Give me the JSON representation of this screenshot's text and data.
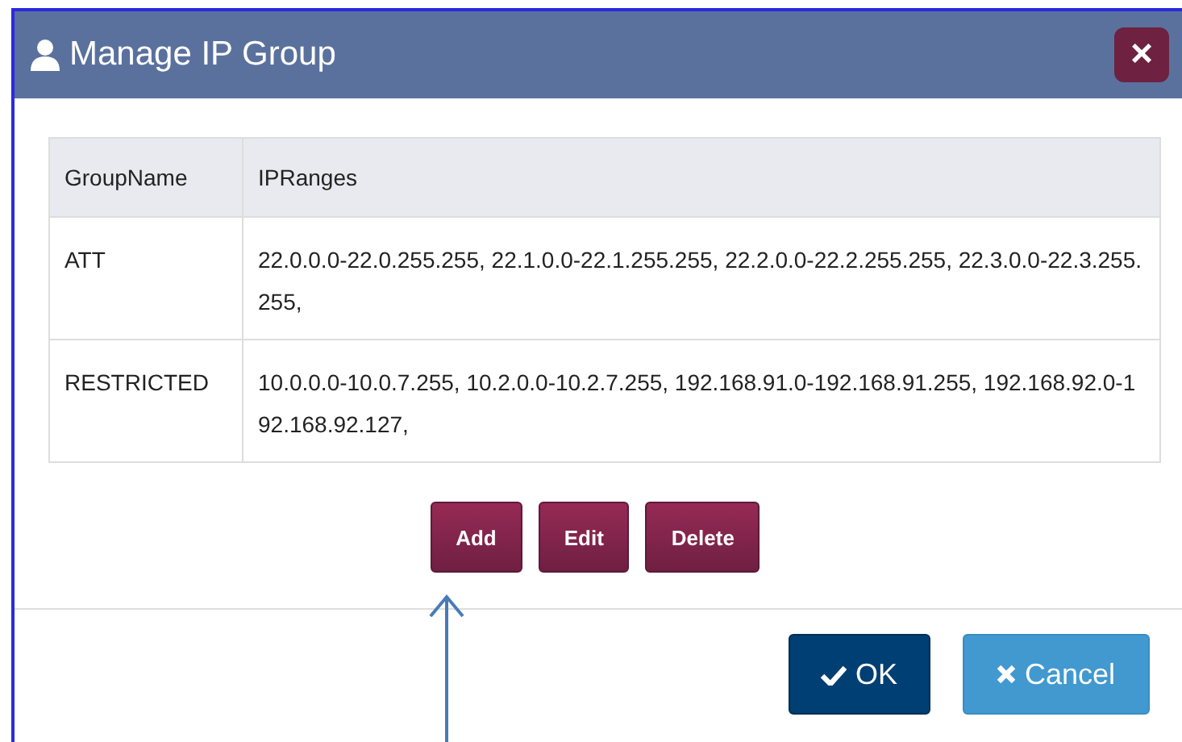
{
  "dialog": {
    "title": "Manage IP Group",
    "close_label": "×"
  },
  "table": {
    "columns": [
      "GroupName",
      "IPRanges"
    ],
    "rows": [
      {
        "group": "ATT",
        "ranges": "22.0.0.0-22.0.255.255, 22.1.0.0-22.1.255.255, 22.2.0.0-22.2.255.255, 22.3.0.0-22.3.255.255,"
      },
      {
        "group": "RESTRICTED",
        "ranges": "10.0.0.0-10.0.7.255, 10.2.0.0-10.2.7.255, 192.168.91.0-192.168.91.255, 192.168.92.0-192.168.92.127,"
      }
    ]
  },
  "actions": [
    "Add",
    "Edit",
    "Delete"
  ],
  "footer_buttons": [
    {
      "label": "OK",
      "kind": "primary"
    },
    {
      "label": "Cancel",
      "kind": "secondary"
    }
  ]
}
